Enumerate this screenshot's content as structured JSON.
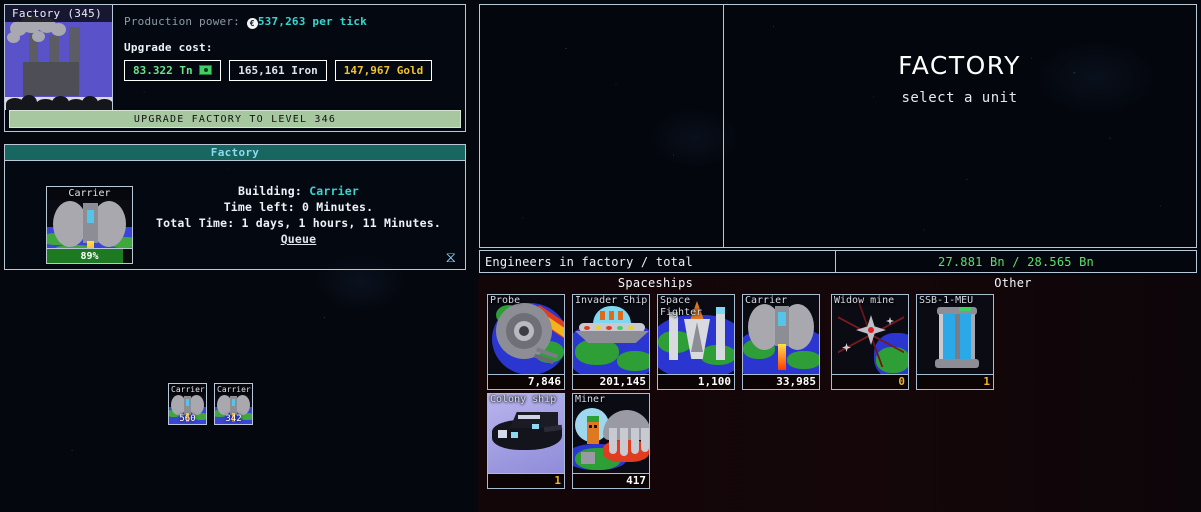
{
  "left": {
    "upgrade_panel": {
      "thumb_title": "Factory (345)",
      "production_label": "Production power:",
      "production_value": "537,263 per tick",
      "coin_glyph": "€",
      "upgrade_cost_label": "Upgrade cost:",
      "costs": [
        {
          "name": "tn-cost",
          "text": "83.322 Tn",
          "has_money_icon": true
        },
        {
          "name": "iron-cost",
          "text": "165,161 Iron",
          "has_money_icon": false
        },
        {
          "name": "gold-cost",
          "text": "147,967 Gold",
          "has_money_icon": false
        }
      ],
      "upgrade_button_label": "UPGRADE FACTORY TO LEVEL 346"
    },
    "production_panel": {
      "header": "Factory",
      "building_label": "Building:",
      "building_unit": "Carrier",
      "time_left": "Time left: 0 Minutes.",
      "total_time": "Total Time: 1 days, 1 hours, 11 Minutes.",
      "queue_link": "Queue",
      "current": {
        "caption": "Carrier",
        "progress": "89%",
        "progress_pct": 89
      },
      "queue": [
        {
          "caption": "Carrier",
          "qty": "560"
        },
        {
          "caption": "Carrier",
          "qty": "342"
        }
      ],
      "hourglass_glyph": "⧖"
    }
  },
  "right": {
    "viewer": {
      "title": "FACTORY",
      "subtitle": "select a unit"
    },
    "engineers": {
      "label": "Engineers in factory / total",
      "value": "27.881 Bn / 28.565 Bn"
    },
    "store": {
      "headers": {
        "spaceships": "Spaceships",
        "other": "Other"
      },
      "units": [
        {
          "name": "probe",
          "caption": "Probe",
          "count": "7,846",
          "gold": false,
          "art": "probe"
        },
        {
          "name": "invader-ship",
          "caption": "Invader Ship",
          "count": "201,145",
          "gold": false,
          "art": "invader"
        },
        {
          "name": "space-fighter",
          "caption": "Space Fighter",
          "count": "1,100",
          "gold": false,
          "art": "fighter"
        },
        {
          "name": "carrier",
          "caption": "Carrier",
          "count": "33,985",
          "gold": false,
          "art": "carrier"
        },
        {
          "name": "widow-mine",
          "caption": "Widow mine",
          "count": "0",
          "gold": true,
          "art": "mine"
        },
        {
          "name": "ssb-1-meu",
          "caption": "SSB-1-MEU",
          "count": "1",
          "gold": true,
          "art": "ssb"
        },
        {
          "name": "colony-ship",
          "caption": "Colony ship",
          "count": "1",
          "gold": true,
          "art": "colony"
        },
        {
          "name": "miner",
          "caption": "Miner",
          "count": "417",
          "gold": false,
          "art": "miner"
        }
      ]
    }
  },
  "colors": {
    "accent_cyan": "#35d8d0",
    "green": "#5ee06a",
    "gold": "#f2c231",
    "teal_header": "#17665f",
    "button_green": "#a6c7a0",
    "border": "#b9c8d6"
  }
}
